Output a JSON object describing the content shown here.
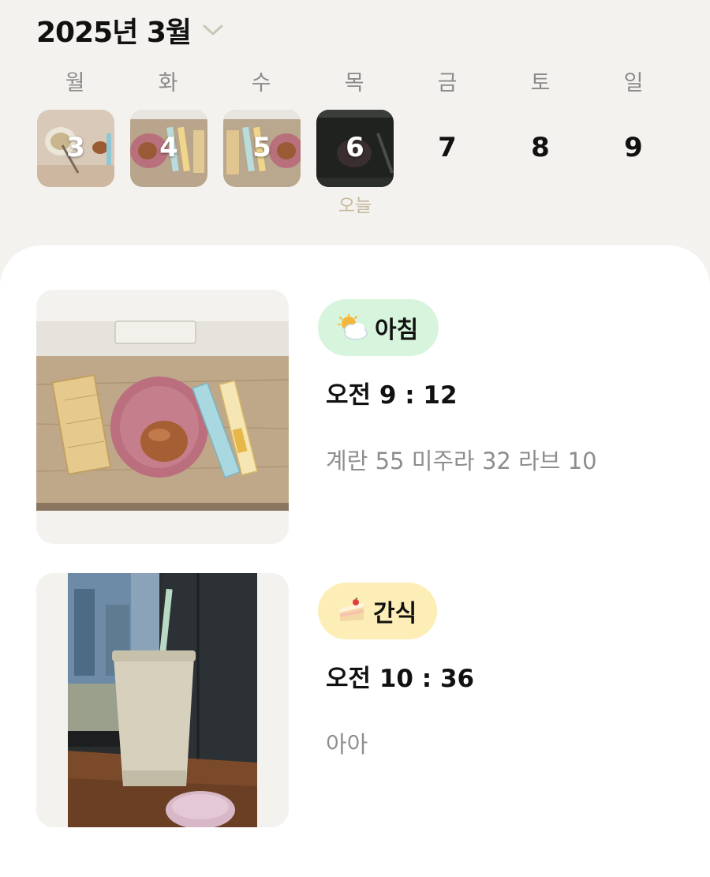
{
  "header": {
    "month_label": "2025년 3월",
    "dropdown_icon": "chevron-down-icon"
  },
  "week": {
    "weekdays": [
      "월",
      "화",
      "수",
      "목",
      "금",
      "토",
      "일"
    ],
    "days": [
      {
        "num": "3",
        "has_photo": true
      },
      {
        "num": "4",
        "has_photo": true
      },
      {
        "num": "5",
        "has_photo": true
      },
      {
        "num": "6",
        "has_photo": true,
        "is_today": true
      },
      {
        "num": "7",
        "has_photo": false
      },
      {
        "num": "8",
        "has_photo": false
      },
      {
        "num": "9",
        "has_photo": false
      }
    ],
    "today_label": "오늘"
  },
  "meals": [
    {
      "tag": "아침",
      "tag_icon": "sun-behind-cloud-icon",
      "tag_color": "#d7f5dc",
      "time": "오전 9 : 12",
      "note": "계란 55 미주라 32 라브 10"
    },
    {
      "tag": "간식",
      "tag_icon": "cake-icon",
      "tag_color": "#fdeeb8",
      "time": "오전 10 : 36",
      "note": "아아"
    }
  ],
  "colors": {
    "page_background": "#f4f2ee",
    "sheet_background": "#ffffff",
    "today_label": "#c5b89c",
    "weekday_text": "#8a8a8a",
    "note_text": "#8e8e8e"
  }
}
